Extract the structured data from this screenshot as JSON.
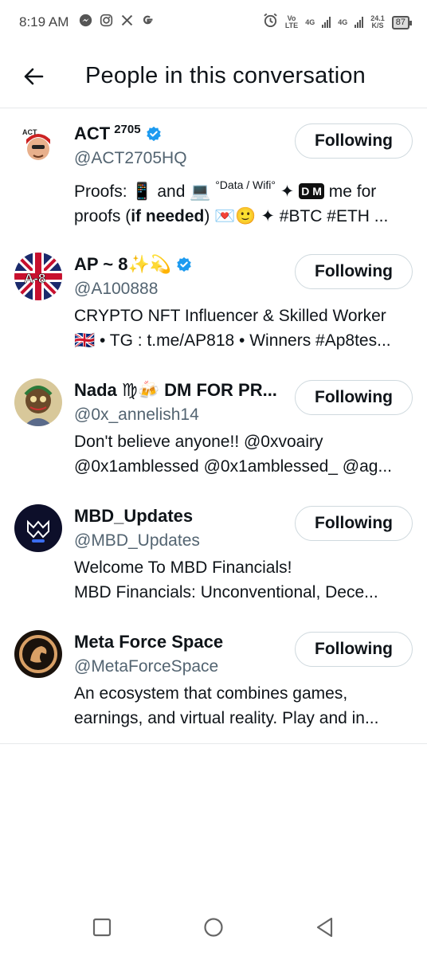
{
  "status_bar": {
    "time": "8:19 AM",
    "apps": [
      "messenger-icon",
      "instagram-icon",
      "x-icon",
      "google-icon"
    ],
    "volte_top": "Vo",
    "volte_bottom": "LTE",
    "net1": "4G",
    "net2": "4G",
    "speed_top": "24.1",
    "speed_bottom": "K/S",
    "battery": "87"
  },
  "header": {
    "title": "People in this conversation"
  },
  "people": [
    {
      "name": "ACT",
      "name_sup": "2705",
      "verified": true,
      "handle": "@ACT2705HQ",
      "button": "Following",
      "bio_line1_a": "Proofs: 📱 and 💻 ",
      "bio_line1_sup": "°Data / Wifi°",
      "bio_line1_b": " ✦ ",
      "bio_line1_dm": "D M",
      "bio_line1_c": " me for",
      "bio_line2_a": "proofs (",
      "bio_line2_bold": "if needed",
      "bio_line2_b": ") 💌🙂 ✦ #BTC #ETH ...",
      "avatar_text": "ACT"
    },
    {
      "name": "AP ~ 8✨💫",
      "verified": true,
      "handle": "@A100888",
      "button": "Following",
      "bio_line1": "CRYPTO NFT Influencer & Skilled Worker",
      "bio_line2": "🇬🇧 • TG : t.me/AP818 • Winners #Ap8tes...",
      "avatar_text": "A-8"
    },
    {
      "name": "Nada ♍🍻 DM FOR PR...",
      "verified": false,
      "handle": "@0x_annelish14",
      "button": "Following",
      "bio_line1": "Don't believe anyone!! @0xvoairy",
      "bio_line2": "@0x1amblessed @0x1amblessed_ @ag..."
    },
    {
      "name": "MBD_Updates",
      "verified": false,
      "handle": "@MBD_Updates",
      "button": "Following",
      "bio_line1": "Welcome To MBD Financials!",
      "bio_line2": "MBD Financials: Unconventional, Dece..."
    },
    {
      "name": "Meta Force Space",
      "verified": false,
      "handle": "@MetaForceSpace",
      "button": "Following",
      "bio_line1": "An ecosystem that combines games,",
      "bio_line2": "earnings, and virtual reality. Play and in..."
    }
  ],
  "colors": {
    "verified": "#1d9bf0",
    "handle": "#536471",
    "divider": "#e6e9eb",
    "button_border": "#cfd9de"
  },
  "nav_icons": [
    "recents-square-icon",
    "home-circle-icon",
    "back-triangle-icon"
  ]
}
